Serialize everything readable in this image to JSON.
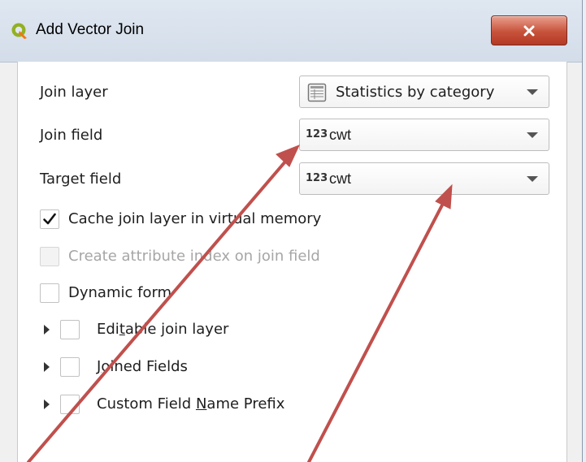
{
  "window": {
    "title": "Add Vector Join",
    "close_glyph": "X",
    "icon": "qgis-logo-icon"
  },
  "form": {
    "join_layer": {
      "label": "Join layer",
      "value": "Statistics by category",
      "icon": "table-layer-icon"
    },
    "join_field": {
      "label": "Join field",
      "type_badge": "123",
      "value": "cwt"
    },
    "target_field": {
      "label": "Target field",
      "type_badge": "123",
      "value": "cwt"
    }
  },
  "options": {
    "cache": {
      "label": "Cache join layer in virtual memory",
      "checked": true,
      "enabled": true
    },
    "attr_index": {
      "label": "Create attribute index on join field",
      "checked": false,
      "enabled": false
    },
    "dynamic_form": {
      "label": "Dynamic form",
      "checked": false,
      "enabled": true
    },
    "editable": {
      "label_pre": "Edi",
      "label_mnemonic": "t",
      "label_post": "able join layer",
      "checked": false,
      "collapsed": true
    },
    "joined_fields": {
      "label_pre": "",
      "label_mnemonic": "J",
      "label_post": "oined Fields",
      "checked": false,
      "collapsed": true
    },
    "prefix": {
      "label_pre": "Custom Field ",
      "label_mnemonic": "N",
      "label_post": "ame Prefix",
      "checked": false,
      "collapsed": true
    }
  },
  "annotations": {
    "arrow_color": "#c0504d"
  }
}
